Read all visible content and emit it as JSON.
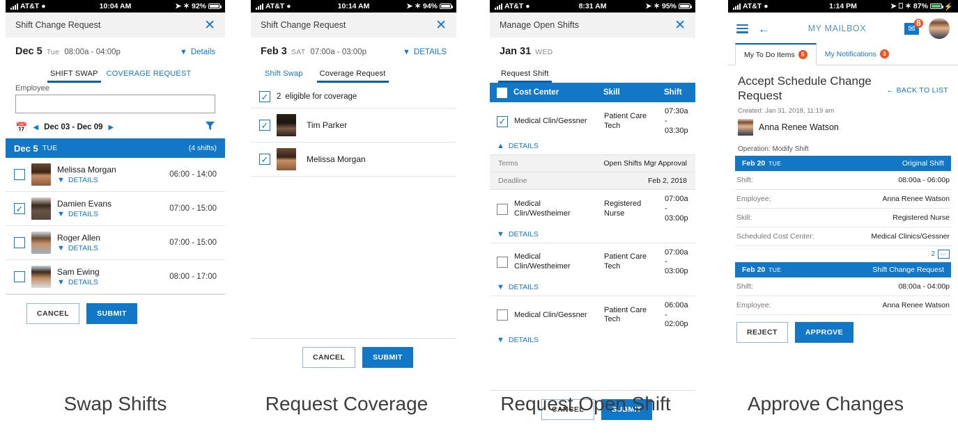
{
  "panels": [
    {
      "id": "swap-shifts",
      "caption": "Swap Shifts",
      "status": {
        "carrier": "AT&T",
        "time": "10:04 AM",
        "battery": "92%"
      },
      "title": "Shift Change Request",
      "close_label": "✕",
      "date": {
        "day": "Dec 5",
        "dow": "Tue",
        "times": "08:00a - 04:00p",
        "details_label": "Details"
      },
      "tabs": [
        {
          "label": "SHIFT SWAP",
          "active": true
        },
        {
          "label": "COVERAGE REQUEST",
          "active": false
        }
      ],
      "employee_label": "Employee",
      "employee_value": "",
      "range": "Dec 03 - Dec 09",
      "day_header": {
        "day": "Dec 5",
        "dow": "TUE",
        "count": "(4 shifts)"
      },
      "rows": [
        {
          "name": "Melissa Morgan",
          "details": "DETAILS",
          "hours": "06:00 - 14:00",
          "checked": false,
          "avatar": "a1"
        },
        {
          "name": "Damien Evans",
          "details": "DETAILS",
          "hours": "07:00 - 15:00",
          "checked": true,
          "avatar": "a2"
        },
        {
          "name": "Roger Allen",
          "details": "DETAILS",
          "hours": "07:00 - 15:00",
          "checked": false,
          "avatar": "a3"
        },
        {
          "name": "Sam Ewing",
          "details": "DETAILS",
          "hours": "08:00 - 17:00",
          "checked": false,
          "avatar": "a4"
        }
      ],
      "buttons": {
        "cancel": "CANCEL",
        "submit": "SUBMIT"
      }
    },
    {
      "id": "request-coverage",
      "caption": "Request Coverage",
      "status": {
        "carrier": "AT&T",
        "time": "10:14 AM",
        "battery": "94%"
      },
      "title": "Shift Change Request",
      "close_label": "✕",
      "date": {
        "day": "Feb 3",
        "dow": "SAT",
        "times": "07:00a - 03:00p",
        "details_label": "DETAILS"
      },
      "tabs": [
        {
          "label": "Shift Swap",
          "active": false
        },
        {
          "label": "Coverage Request",
          "active": true
        }
      ],
      "eligible": {
        "count": "2",
        "label": "eligible for coverage",
        "checked": true
      },
      "rows": [
        {
          "name": "Tim Parker",
          "checked": true,
          "avatar": "a5"
        },
        {
          "name": "Melissa Morgan",
          "checked": true,
          "avatar": "a1"
        }
      ],
      "buttons": {
        "cancel": "CANCEL",
        "submit": "SUBMIT"
      }
    },
    {
      "id": "request-open-shift",
      "caption": "Request Open Shift",
      "status": {
        "carrier": "AT&T",
        "time": "8:31 AM",
        "battery": "95%"
      },
      "title": "Manage Open Shifts",
      "close_label": "✕",
      "date": {
        "day": "Jan 31",
        "dow": "WED"
      },
      "tabs": [
        {
          "label": "Request Shift",
          "active": true
        }
      ],
      "table_headers": {
        "cost_center": "Cost Center",
        "skill": "Skill",
        "shift": "Shift"
      },
      "rows": [
        {
          "cost_center": "Medical Clin/Gessner",
          "skill": "Patient Care Tech",
          "shift": "07:30a - 03:30p",
          "checked": true,
          "details_label": "DETAILS",
          "expanded": true,
          "details": [
            {
              "key": "Terms",
              "value": "Open Shifts Mgr Approval"
            },
            {
              "key": "Deadline",
              "value": "Feb 2, 2018"
            }
          ]
        },
        {
          "cost_center": "Medical Clin/Westheimer",
          "skill": "Registered Nurse",
          "shift": "07:00a - 03:00p",
          "checked": false,
          "details_label": "DETAILS",
          "expanded": false,
          "details": []
        },
        {
          "cost_center": "Medical Clin/Westheimer",
          "skill": "Patient Care Tech",
          "shift": "07:00a - 03:00p",
          "checked": false,
          "details_label": "DETAILS",
          "expanded": false,
          "details": []
        },
        {
          "cost_center": "Medical Clin/Gessner",
          "skill": "Patient Care Tech",
          "shift": "06:00a - 02:00p",
          "checked": false,
          "details_label": "DETAILS",
          "expanded": false,
          "details": []
        }
      ],
      "buttons": {
        "cancel": "CANCEL",
        "submit": "SUBMIT"
      }
    },
    {
      "id": "approve-changes",
      "caption": "Approve Changes",
      "status": {
        "carrier": "AT&T",
        "time": "1:14 PM",
        "battery": "87%"
      },
      "mailbox_title": "MY MAILBOX",
      "mail_badge": "8",
      "mtabs": [
        {
          "label": "My To Do Items",
          "badge": "5",
          "active": true
        },
        {
          "label": "My Notifications",
          "badge": "3",
          "active": false
        }
      ],
      "request_title": "Accept Schedule Change Request",
      "back_to_list": "← BACK TO LIST",
      "created": "Created: Jan 31, 2018, 11:19 am",
      "person": "Anna Renee Watson",
      "operation": "Operation: Modify Shift",
      "original": {
        "date": "Feb 20",
        "dow": "TUE",
        "label": "Original Shift",
        "fields": [
          {
            "key": "Shift:",
            "value": "08:00a - 06:00p"
          },
          {
            "key": "Employee:",
            "value": "Anna Renee Watson"
          },
          {
            "key": "Skill:",
            "value": "Registered Nurse"
          },
          {
            "key": "Scheduled Cost Center:",
            "value": "Medical Clinics/Gessner"
          }
        ],
        "comment_count": "2"
      },
      "change": {
        "date": "Feb 20",
        "dow": "TUE",
        "label": "Shift Change Request",
        "fields": [
          {
            "key": "Shift:",
            "value": "08:00a - 04:00p"
          },
          {
            "key": "Employee:",
            "value": "Anna Renee Watson"
          }
        ]
      },
      "buttons": {
        "reject": "REJECT",
        "approve": "APPROVE"
      }
    }
  ],
  "colors": {
    "accent": "#1277c7",
    "tab_underline": "#0d5fa4",
    "badge": "#f4511e"
  }
}
